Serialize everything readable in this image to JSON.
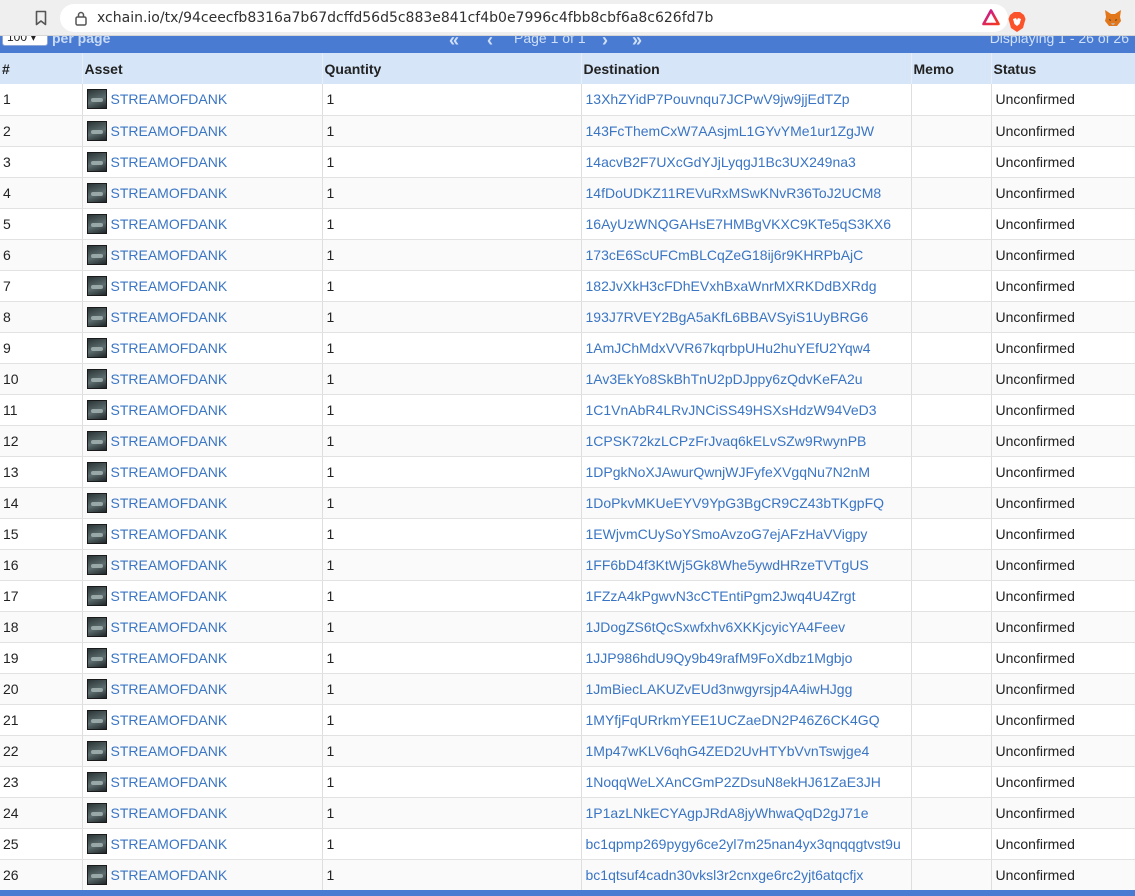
{
  "browser": {
    "url": "xchain.io/tx/94ceecfb8316a7b67dcffd56d5c883e841cf4b0e7996c4fbb8cbf6a8c626fd7b"
  },
  "pager": {
    "per_page_value": "100",
    "per_page_label": "per page",
    "page_label": "Page 1 of 1",
    "display_label": "Displaying 1 - 26 of 26"
  },
  "columns": [
    "#",
    "Asset",
    "Quantity",
    "Destination",
    "Memo",
    "Status"
  ],
  "rows": [
    {
      "n": "1",
      "asset": "STREAMOFDANK",
      "qty": "1",
      "dest": "13XhZYidP7Pouvnqu7JCPwV9jw9jjEdTZp",
      "memo": "",
      "status": "Unconfirmed"
    },
    {
      "n": "2",
      "asset": "STREAMOFDANK",
      "qty": "1",
      "dest": "143FcThemCxW7AAsjmL1GYvYMe1ur1ZgJW",
      "memo": "",
      "status": "Unconfirmed"
    },
    {
      "n": "3",
      "asset": "STREAMOFDANK",
      "qty": "1",
      "dest": "14acvB2F7UXcGdYJjLyqgJ1Bc3UX249na3",
      "memo": "",
      "status": "Unconfirmed"
    },
    {
      "n": "4",
      "asset": "STREAMOFDANK",
      "qty": "1",
      "dest": "14fDoUDKZ11REVuRxMSwKNvR36ToJ2UCM8",
      "memo": "",
      "status": "Unconfirmed"
    },
    {
      "n": "5",
      "asset": "STREAMOFDANK",
      "qty": "1",
      "dest": "16AyUzWNQGAHsE7HMBgVKXC9KTe5qS3KX6",
      "memo": "",
      "status": "Unconfirmed"
    },
    {
      "n": "6",
      "asset": "STREAMOFDANK",
      "qty": "1",
      "dest": "173cE6ScUFCmBLCqZeG18ij6r9KHRPbAjC",
      "memo": "",
      "status": "Unconfirmed"
    },
    {
      "n": "7",
      "asset": "STREAMOFDANK",
      "qty": "1",
      "dest": "182JvXkH3cFDhEVxhBxaWnrMXRKDdBXRdg",
      "memo": "",
      "status": "Unconfirmed"
    },
    {
      "n": "8",
      "asset": "STREAMOFDANK",
      "qty": "1",
      "dest": "193J7RVEY2BgA5aKfL6BBAVSyiS1UyBRG6",
      "memo": "",
      "status": "Unconfirmed"
    },
    {
      "n": "9",
      "asset": "STREAMOFDANK",
      "qty": "1",
      "dest": "1AmJChMdxVVR67kqrbpUHu2huYEfU2Yqw4",
      "memo": "",
      "status": "Unconfirmed"
    },
    {
      "n": "10",
      "asset": "STREAMOFDANK",
      "qty": "1",
      "dest": "1Av3EkYo8SkBhTnU2pDJppy6zQdvKeFA2u",
      "memo": "",
      "status": "Unconfirmed"
    },
    {
      "n": "11",
      "asset": "STREAMOFDANK",
      "qty": "1",
      "dest": "1C1VnAbR4LRvJNCiSS49HSXsHdzW94VeD3",
      "memo": "",
      "status": "Unconfirmed"
    },
    {
      "n": "12",
      "asset": "STREAMOFDANK",
      "qty": "1",
      "dest": "1CPSK72kzLCPzFrJvaq6kELvSZw9RwynPB",
      "memo": "",
      "status": "Unconfirmed"
    },
    {
      "n": "13",
      "asset": "STREAMOFDANK",
      "qty": "1",
      "dest": "1DPgkNoXJAwurQwnjWJFyfeXVgqNu7N2nM",
      "memo": "",
      "status": "Unconfirmed"
    },
    {
      "n": "14",
      "asset": "STREAMOFDANK",
      "qty": "1",
      "dest": "1DoPkvMKUeEYV9YpG3BgCR9CZ43bTKgpFQ",
      "memo": "",
      "status": "Unconfirmed"
    },
    {
      "n": "15",
      "asset": "STREAMOFDANK",
      "qty": "1",
      "dest": "1EWjvmCUySoYSmoAvzoG7ejAFzHaVVigpy",
      "memo": "",
      "status": "Unconfirmed"
    },
    {
      "n": "16",
      "asset": "STREAMOFDANK",
      "qty": "1",
      "dest": "1FF6bD4f3KtWj5Gk8Whe5ywdHRzeTVTgUS",
      "memo": "",
      "status": "Unconfirmed"
    },
    {
      "n": "17",
      "asset": "STREAMOFDANK",
      "qty": "1",
      "dest": "1FZzA4kPgwvN3cCTEntiPgm2Jwq4U4Zrgt",
      "memo": "",
      "status": "Unconfirmed"
    },
    {
      "n": "18",
      "asset": "STREAMOFDANK",
      "qty": "1",
      "dest": "1JDogZS6tQcSxwfxhv6XKKjcyicYA4Feev",
      "memo": "",
      "status": "Unconfirmed"
    },
    {
      "n": "19",
      "asset": "STREAMOFDANK",
      "qty": "1",
      "dest": "1JJP986hdU9Qy9b49rafM9FoXdbz1Mgbjo",
      "memo": "",
      "status": "Unconfirmed"
    },
    {
      "n": "20",
      "asset": "STREAMOFDANK",
      "qty": "1",
      "dest": "1JmBiecLAKUZvEUd3nwgyrsjp4A4iwHJgg",
      "memo": "",
      "status": "Unconfirmed"
    },
    {
      "n": "21",
      "asset": "STREAMOFDANK",
      "qty": "1",
      "dest": "1MYfjFqURrkmYEE1UCZaeDN2P46Z6CK4GQ",
      "memo": "",
      "status": "Unconfirmed"
    },
    {
      "n": "22",
      "asset": "STREAMOFDANK",
      "qty": "1",
      "dest": "1Mp47wKLV6qhG4ZED2UvHTYbVvnTswjge4",
      "memo": "",
      "status": "Unconfirmed"
    },
    {
      "n": "23",
      "asset": "STREAMOFDANK",
      "qty": "1",
      "dest": "1NoqqWeLXAnCGmP2ZDsuN8ekHJ61ZaE3JH",
      "memo": "",
      "status": "Unconfirmed"
    },
    {
      "n": "24",
      "asset": "STREAMOFDANK",
      "qty": "1",
      "dest": "1P1azLNkECYAgpJRdA8jyWhwaQqD2gJ71e",
      "memo": "",
      "status": "Unconfirmed"
    },
    {
      "n": "25",
      "asset": "STREAMOFDANK",
      "qty": "1",
      "dest": "bc1qpmp269pygy6ce2yl7m25nan4yx3qnqqgtvst9u",
      "memo": "",
      "status": "Unconfirmed"
    },
    {
      "n": "26",
      "asset": "STREAMOFDANK",
      "qty": "1",
      "dest": "bc1qtsuf4cadn30vksl3r2cnxge6rc2yjt6atqcfjx",
      "memo": "",
      "status": "Unconfirmed"
    }
  ],
  "icons": {
    "bookmark": "bookmark-icon",
    "lock": "lock-icon",
    "brave": "brave-lion-icon",
    "rewards": "brave-rewards-triangle-icon",
    "metamask": "metamask-fox-icon"
  }
}
